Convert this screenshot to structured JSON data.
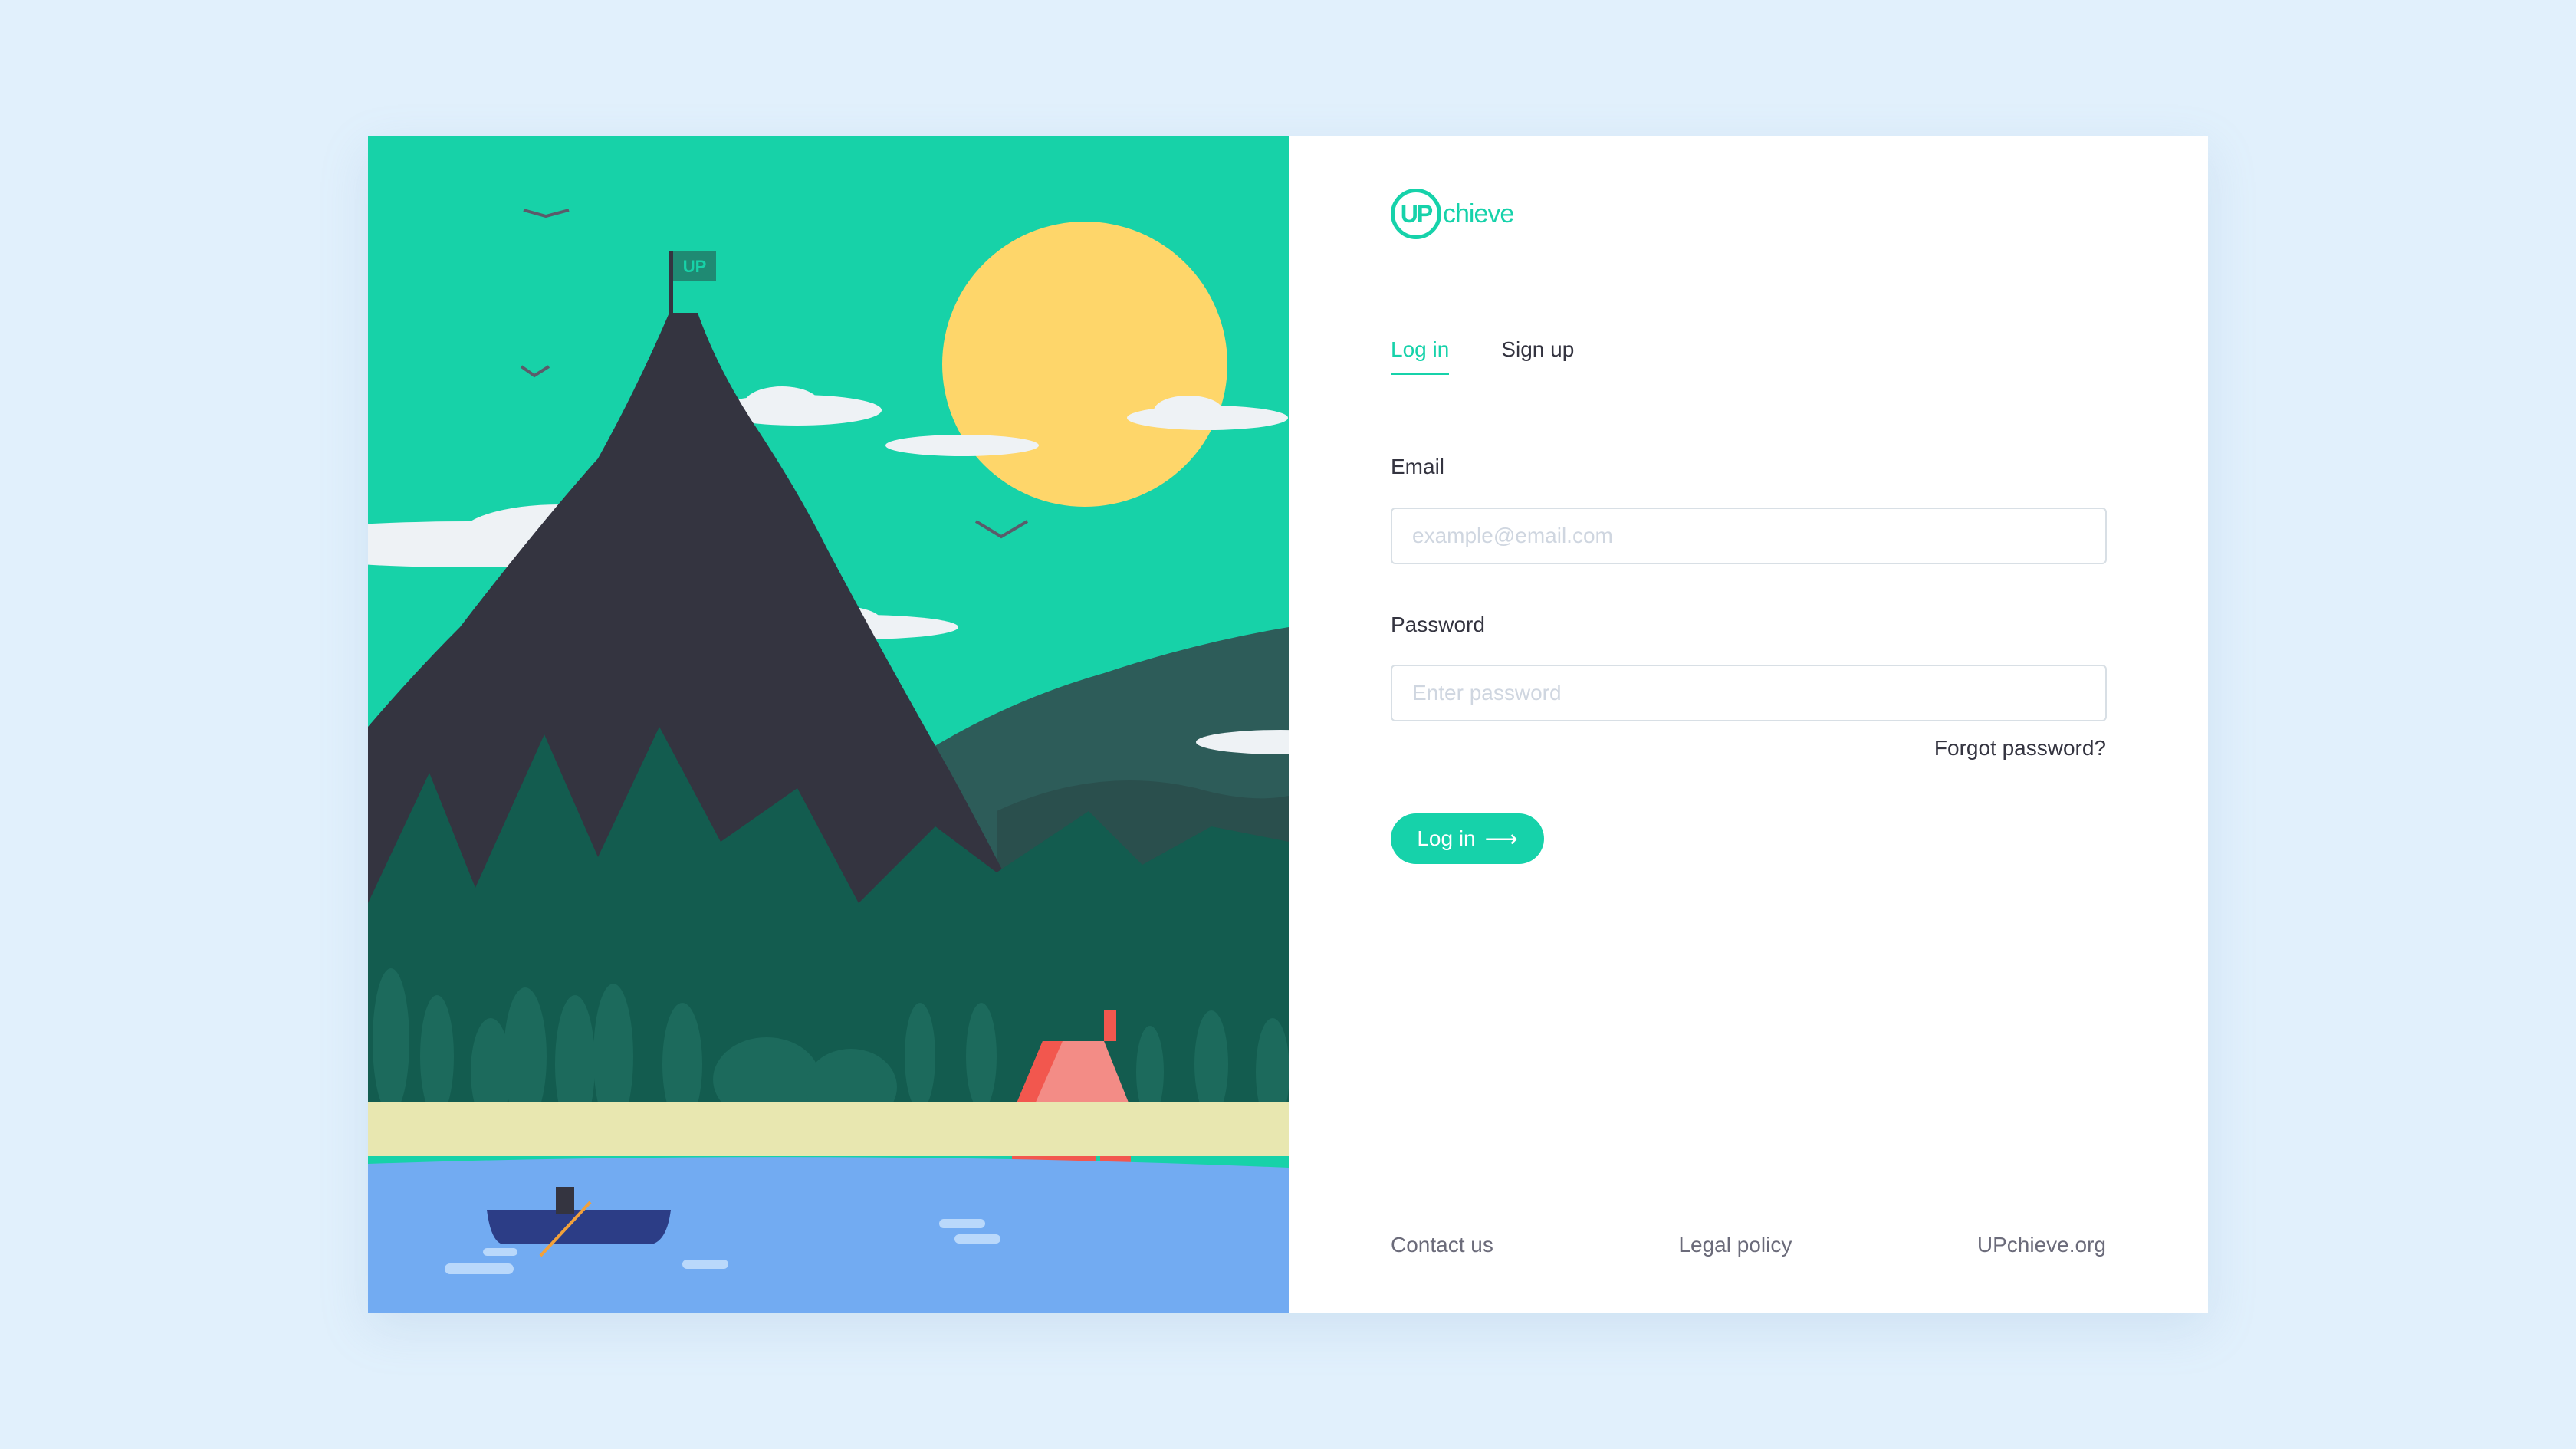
{
  "brand": {
    "logo_mark": "UP",
    "logo_text": "chieve",
    "flag_text": "UP"
  },
  "tabs": [
    {
      "label": "Log in",
      "active": true
    },
    {
      "label": "Sign up",
      "active": false
    }
  ],
  "form": {
    "email_label": "Email",
    "email_placeholder": "example@email.com",
    "email_value": "",
    "password_label": "Password",
    "password_placeholder": "Enter password",
    "password_value": "",
    "forgot_password": "Forgot password?",
    "submit_label": "Log in",
    "submit_icon": "arrow-right-icon"
  },
  "footer": {
    "links": [
      "Contact us",
      "Legal policy",
      "UPchieve.org"
    ]
  },
  "colors": {
    "accent": "#16d2aa",
    "page_bg": "#e1f0fc",
    "text": "#343440",
    "sky": "#17d2a8",
    "sun": "#fed66a",
    "mountain": "#343440",
    "lake": "#72abf2",
    "cabin": "#f2574e"
  }
}
